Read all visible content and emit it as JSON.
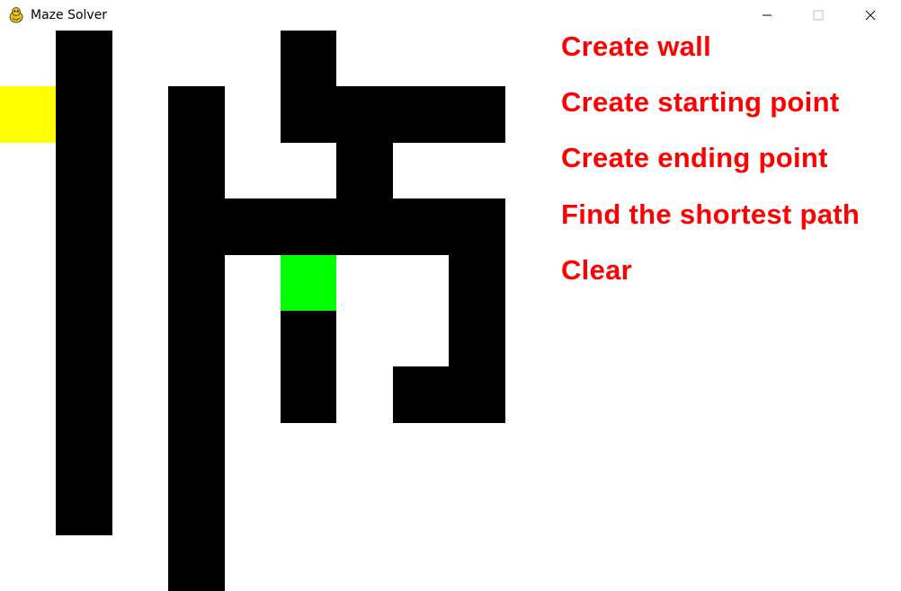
{
  "window": {
    "title": "Maze Solver",
    "icon": "pygame-snake-icon",
    "controls": [
      "minimize-icon",
      "maximize-icon",
      "close-icon"
    ]
  },
  "colors": {
    "wall": "#000000",
    "start": "#ffff00",
    "end": "#00ff00",
    "menu_text": "#ff0000",
    "background": "#ffffff"
  },
  "menu": {
    "create_wall": "Create wall",
    "create_start": "Create starting point",
    "create_end": "Create ending point",
    "find_path": "Find the shortest path",
    "clear": "Clear"
  },
  "maze": {
    "walls": [
      [
        1,
        0
      ],
      [
        1,
        1
      ],
      [
        1,
        2
      ],
      [
        1,
        3
      ],
      [
        1,
        4
      ],
      [
        1,
        5
      ],
      [
        1,
        6
      ],
      [
        1,
        7
      ],
      [
        1,
        8
      ],
      [
        3,
        1
      ],
      [
        3,
        2
      ],
      [
        3,
        3
      ],
      [
        3,
        4
      ],
      [
        3,
        5
      ],
      [
        3,
        6
      ],
      [
        3,
        7
      ],
      [
        3,
        8
      ],
      [
        3,
        9
      ],
      [
        4,
        3
      ],
      [
        5,
        0
      ],
      [
        5,
        1
      ],
      [
        5,
        3
      ],
      [
        5,
        5
      ],
      [
        5,
        6
      ],
      [
        6,
        1
      ],
      [
        6,
        2
      ],
      [
        6,
        3
      ],
      [
        7,
        1
      ],
      [
        7,
        3
      ],
      [
        7,
        6
      ],
      [
        8,
        1
      ],
      [
        8,
        3
      ],
      [
        8,
        4
      ],
      [
        8,
        5
      ],
      [
        8,
        6
      ]
    ],
    "start": [
      0,
      1
    ],
    "end": [
      5,
      4
    ]
  }
}
